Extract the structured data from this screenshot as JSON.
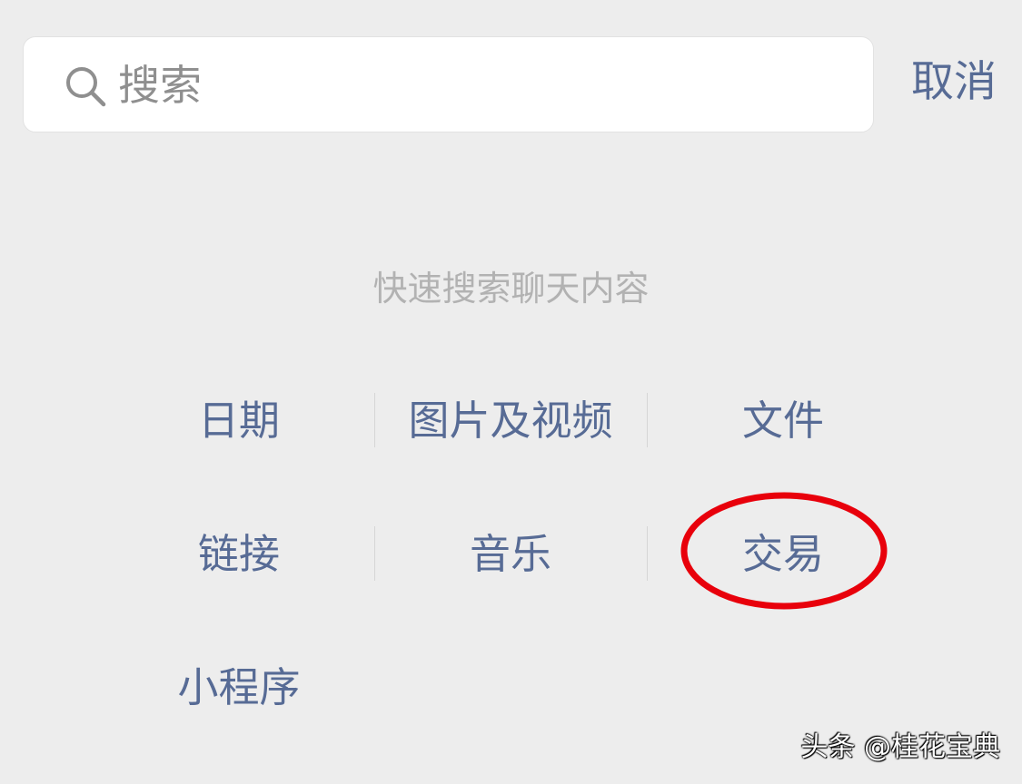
{
  "search": {
    "placeholder": "搜索",
    "value": ""
  },
  "cancel_label": "取消",
  "hint": "快速搜索聊天内容",
  "categories": [
    {
      "label": "日期"
    },
    {
      "label": "图片及视频"
    },
    {
      "label": "文件"
    },
    {
      "label": "链接"
    },
    {
      "label": "音乐"
    },
    {
      "label": "交易"
    },
    {
      "label": "小程序"
    }
  ],
  "highlight": {
    "target": "交易",
    "color": "#e8000b"
  },
  "watermark": "头条 @桂花宝典",
  "colors": {
    "background": "#ededed",
    "link": "#576b95",
    "hint": "#b2b2b2",
    "placeholder": "#8f8f8f"
  },
  "icons": {
    "search": "search-icon"
  }
}
